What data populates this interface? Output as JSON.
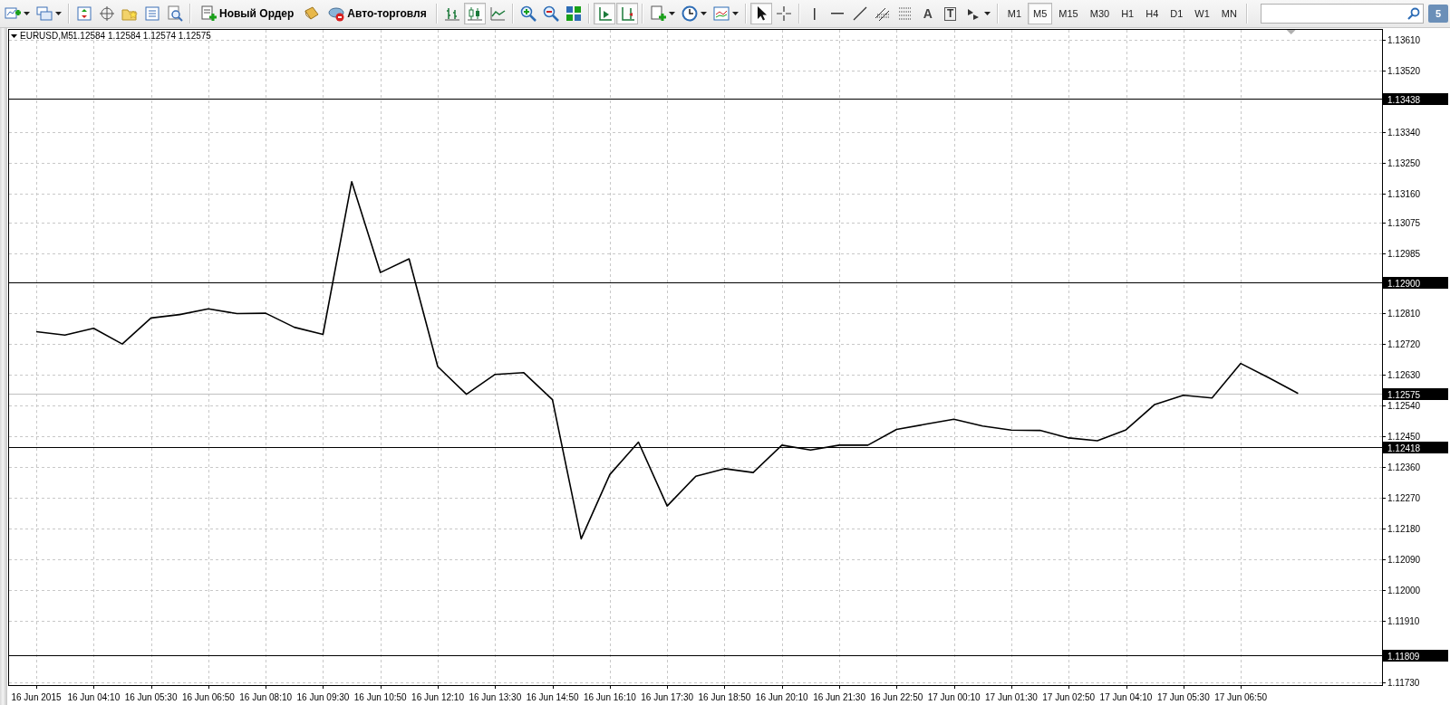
{
  "toolbar": {
    "new_order": "Новый Ордер",
    "auto_trading": "Авто-торговля",
    "chart_type": [
      {
        "selected": false
      },
      {
        "selected": true
      },
      {
        "selected": false
      }
    ],
    "auto_scroll": {
      "on": true
    },
    "chart_shift": {
      "on": true
    },
    "cursor_mode": [
      {
        "selected": true
      },
      {
        "selected": false
      }
    ],
    "text_tool": "A",
    "label_tool": "T"
  },
  "timeframes": [
    {
      "label": "M1",
      "selected": false
    },
    {
      "label": "M5",
      "selected": true
    },
    {
      "label": "M15",
      "selected": false
    },
    {
      "label": "M30",
      "selected": false
    },
    {
      "label": "H1",
      "selected": false
    },
    {
      "label": "H4",
      "selected": false
    },
    {
      "label": "D1",
      "selected": false
    },
    {
      "label": "W1",
      "selected": false
    },
    {
      "label": "MN",
      "selected": false
    }
  ],
  "notifications": {
    "count": "5"
  },
  "chart": {
    "ohlc": "1.12584 1.12584 1.12574 1.12575",
    "chart_data": {
      "type": "line",
      "grid": true,
      "ylim": [
        1.11722,
        1.13639
      ],
      "categories": [
        "16 Jun 2015",
        null,
        "16 Jun 04:10",
        null,
        "16 Jun 05:30",
        null,
        "16 Jun 06:50",
        null,
        "16 Jun 08:10",
        null,
        "16 Jun 09:30",
        null,
        "16 Jun 10:50",
        null,
        "16 Jun 12:10",
        null,
        "16 Jun 13:30",
        null,
        "16 Jun 14:50",
        null,
        "16 Jun 16:10",
        null,
        "16 Jun 17:30",
        null,
        "16 Jun 18:50",
        null,
        "16 Jun 20:10",
        null,
        "16 Jun 21:30",
        null,
        "16 Jun 22:50",
        null,
        "17 Jun 00:10",
        null,
        "17 Jun 01:30",
        null,
        "17 Jun 02:50",
        null,
        "17 Jun 04:10",
        null,
        "17 Jun 05:30",
        null,
        "17 Jun 06:50",
        null,
        null
      ],
      "series": [
        {
          "name": "EURUSD,M5",
          "color": "#000000",
          "values": [
            1.12756,
            1.12746,
            1.12766,
            1.1272,
            1.12796,
            1.12806,
            1.12823,
            1.12809,
            1.1281,
            1.12769,
            1.12748,
            1.13195,
            1.12929,
            1.12969,
            1.12654,
            1.12573,
            1.12631,
            1.12636,
            1.12557,
            1.1215,
            1.12338,
            1.12433,
            1.12246,
            1.12333,
            1.12355,
            1.12344,
            1.12424,
            1.1241,
            1.12424,
            1.12424,
            1.1247,
            1.12485,
            1.125,
            1.1248,
            1.12468,
            1.12467,
            1.12445,
            1.12437,
            1.12469,
            1.12543,
            1.1257,
            1.12562,
            1.12663,
            1.1262,
            1.12575
          ]
        }
      ],
      "yticks": [
        {
          "value": 1.1361,
          "label": "1.13610"
        },
        {
          "value": 1.1352,
          "label": "1.13520"
        },
        {
          "value": 1.1334,
          "label": "1.13340"
        },
        {
          "value": 1.1325,
          "label": "1.13250"
        },
        {
          "value": 1.1316,
          "label": "1.13160"
        },
        {
          "value": 1.13075,
          "label": "1.13075"
        },
        {
          "value": 1.12985,
          "label": "1.12985"
        },
        {
          "value": 1.1281,
          "label": "1.12810"
        },
        {
          "value": 1.1272,
          "label": "1.12720"
        },
        {
          "value": 1.1263,
          "label": "1.12630"
        },
        {
          "value": 1.1254,
          "label": "1.12540"
        },
        {
          "value": 1.1245,
          "label": "1.12450"
        },
        {
          "value": 1.1236,
          "label": "1.12360"
        },
        {
          "value": 1.1227,
          "label": "1.12270"
        },
        {
          "value": 1.1218,
          "label": "1.12180"
        },
        {
          "value": 1.1209,
          "label": "1.12090"
        },
        {
          "value": 1.12,
          "label": "1.12000"
        },
        {
          "value": 1.1191,
          "label": "1.11910"
        },
        {
          "value": 1.1173,
          "label": "1.11730"
        }
      ],
      "ref_lines": [
        {
          "axis": "y",
          "value": 1.13438,
          "label": "1.13438",
          "color": "#000000"
        },
        {
          "axis": "y",
          "value": 1.129,
          "label": "1.12900",
          "color": "#000000"
        },
        {
          "axis": "y",
          "value": 1.12575,
          "label": "1.12575",
          "color": "#c0c0c0"
        },
        {
          "axis": "y",
          "value": 1.12418,
          "label": "1.12418",
          "color": "#000000"
        },
        {
          "axis": "y",
          "value": 1.11809,
          "label": "1.11809",
          "color": "#000000"
        }
      ]
    }
  }
}
